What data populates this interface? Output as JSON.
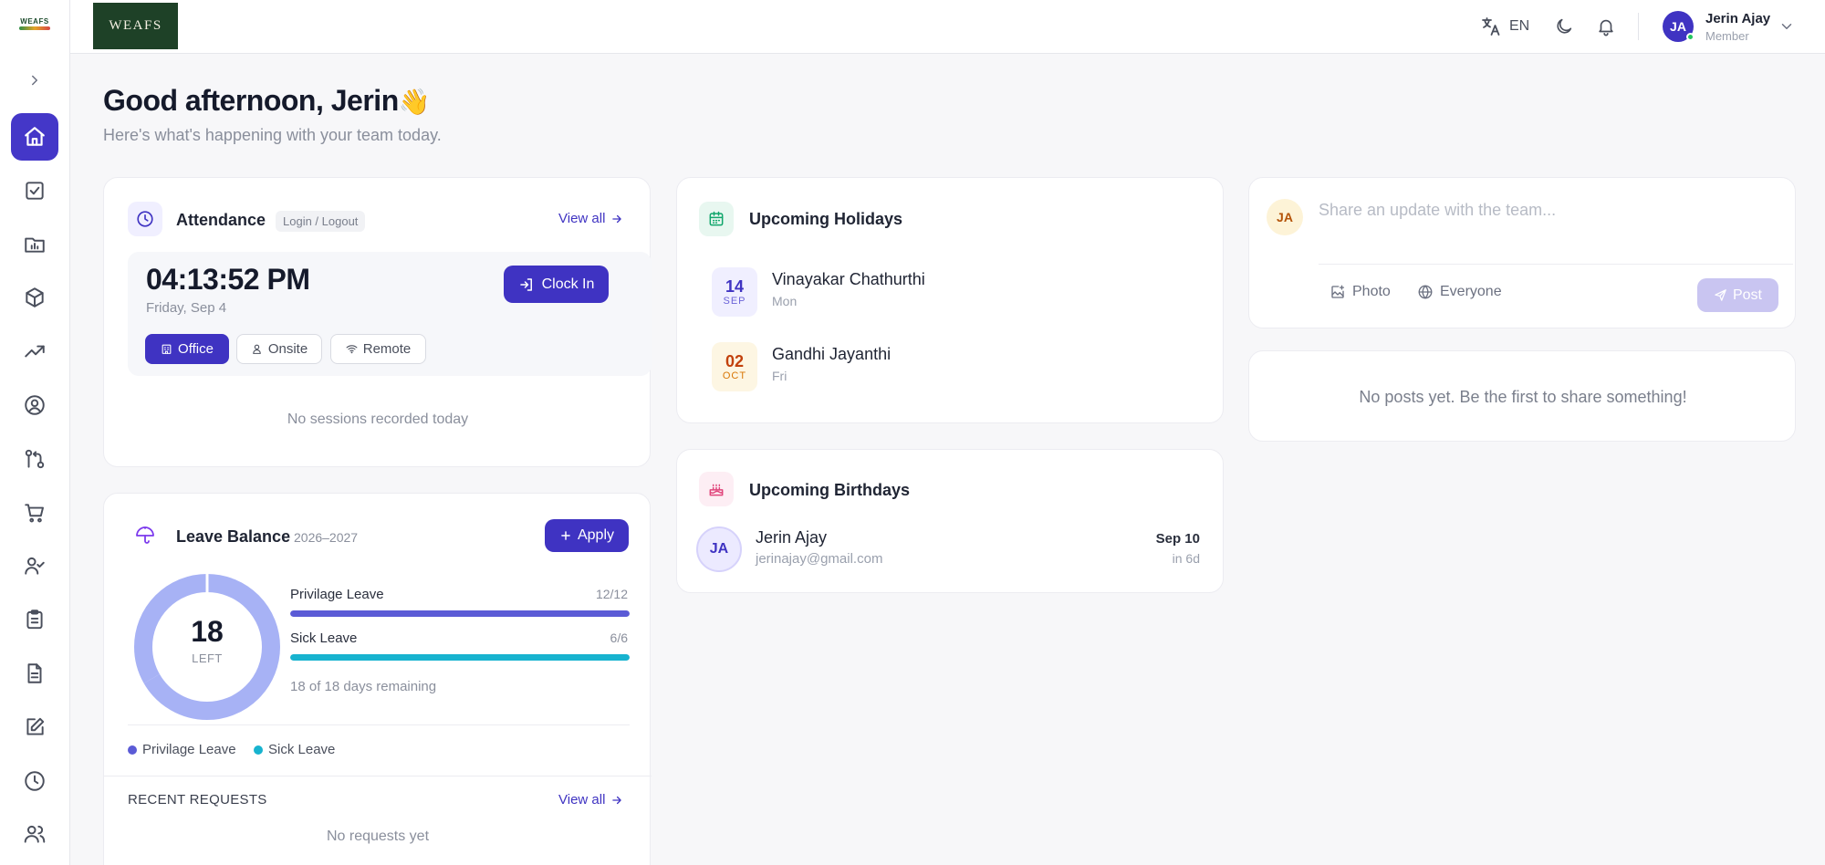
{
  "brand": {
    "sidebar_logo_text": "WEAFS",
    "top_logo_text": "WEAFS"
  },
  "topbar": {
    "language": "EN",
    "user_name": "Jerin Ajay",
    "user_role": "Member",
    "user_initials": "JA"
  },
  "greeting": {
    "title": "Good afternoon, Jerin",
    "emoji": "👋",
    "subtitle": "Here's what's happening with your team today."
  },
  "sidebar": {
    "items": [
      {
        "name": "home-icon",
        "active": true
      },
      {
        "name": "tasks-icon"
      },
      {
        "name": "projects-icon"
      },
      {
        "name": "assets-icon"
      },
      {
        "name": "analytics-icon"
      },
      {
        "name": "profile-icon"
      },
      {
        "name": "workflow-icon"
      },
      {
        "name": "cart-icon"
      },
      {
        "name": "user-check-icon"
      },
      {
        "name": "clipboard-icon"
      },
      {
        "name": "document-icon"
      },
      {
        "name": "edit-icon"
      },
      {
        "name": "clock-icon"
      },
      {
        "name": "team-icon"
      }
    ]
  },
  "attendance": {
    "title": "Attendance",
    "badge": "Login / Logout",
    "view_all": "View all",
    "time": "04:13:52 PM",
    "date": "Friday, Sep 4",
    "clock_in_label": "Clock In",
    "modes": [
      {
        "label": "Office",
        "active": true
      },
      {
        "label": "Onsite",
        "active": false
      },
      {
        "label": "Remote",
        "active": false
      }
    ],
    "empty": "No sessions recorded today"
  },
  "leave": {
    "title": "Leave Balance",
    "period": "2026–2027",
    "apply_label": "Apply",
    "left_count": "18",
    "left_label": "LEFT",
    "types": [
      {
        "name": "Privilage Leave",
        "value": "12/12",
        "fraction": 1.0,
        "color": "#5b5bd6"
      },
      {
        "name": "Sick Leave",
        "value": "6/6",
        "fraction": 1.0,
        "color": "#17b3cf"
      }
    ],
    "remaining": "18 of 18 days remaining",
    "legend": [
      {
        "label": "Privilage Leave",
        "color": "#5b5bd6"
      },
      {
        "label": "Sick Leave",
        "color": "#17b3cf"
      }
    ],
    "recent_title": "RECENT REQUESTS",
    "recent_view_all": "View all",
    "recent_empty": "No requests yet"
  },
  "holidays": {
    "title": "Upcoming Holidays",
    "items": [
      {
        "day": "14",
        "month": "SEP",
        "name": "Vinayakar Chathurthi",
        "weekday": "Mon"
      },
      {
        "day": "02",
        "month": "OCT",
        "name": "Gandhi Jayanthi",
        "weekday": "Fri"
      }
    ]
  },
  "birthdays": {
    "title": "Upcoming Birthdays",
    "items": [
      {
        "initials": "JA",
        "name": "Jerin Ajay",
        "email": "jerinajay@gmail.com",
        "date": "Sep 10",
        "in": "in 6d"
      }
    ]
  },
  "composer": {
    "initials": "JA",
    "placeholder": "Share an update with the team...",
    "photo_label": "Photo",
    "audience_label": "Everyone",
    "post_label": "Post"
  },
  "feed": {
    "empty": "No posts yet. Be the first to share something!"
  }
}
